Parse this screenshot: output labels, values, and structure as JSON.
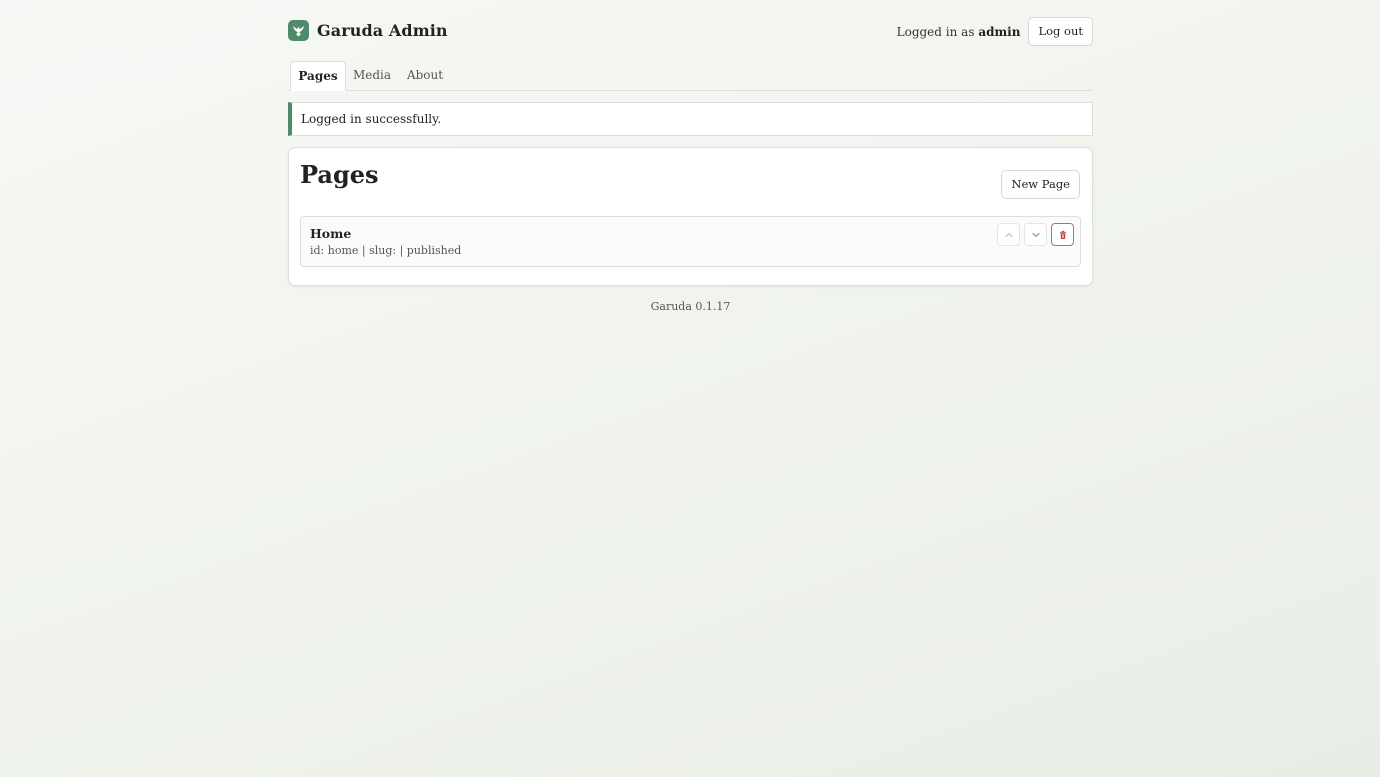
{
  "header": {
    "brand_title": "Garuda Admin",
    "login_prefix": "Logged in as",
    "username": "admin",
    "logout_label": "Log out"
  },
  "tabs": [
    {
      "label": "Pages",
      "active": true
    },
    {
      "label": "Media",
      "active": false
    },
    {
      "label": "About",
      "active": false
    }
  ],
  "flash": {
    "message": "Logged in successfully."
  },
  "pages_panel": {
    "title": "Pages",
    "new_page_label": "New Page",
    "items": [
      {
        "title": "Home",
        "meta": "id: home | slug: | published"
      }
    ]
  },
  "footer": {
    "version": "Garuda 0.1.17"
  },
  "colors": {
    "accent": "#4f8a6b",
    "danger": "#b8454c",
    "border": "#dcdfda"
  },
  "icons": {
    "logo": "garuda-logo-icon",
    "move_up": "chevron-up-icon",
    "move_down": "chevron-down-icon",
    "delete": "trash-icon"
  }
}
